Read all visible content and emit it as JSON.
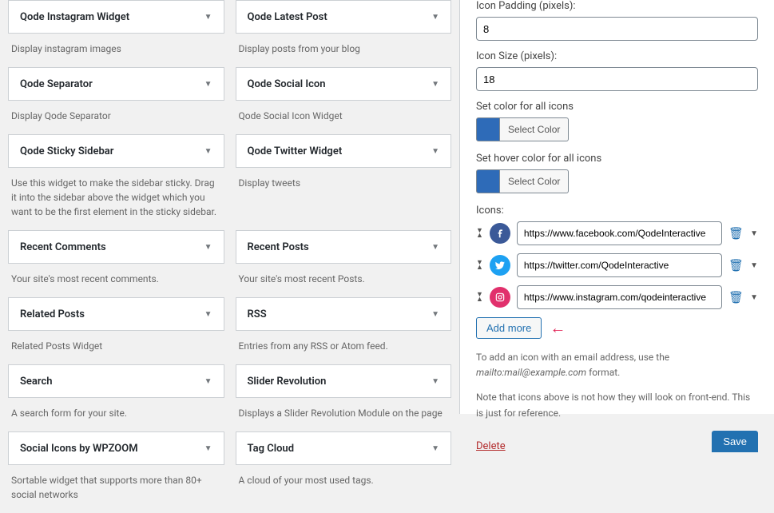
{
  "widgets_left": [
    {
      "title": "Qode Instagram Widget",
      "desc": "Display instagram images"
    },
    {
      "title": "Qode Separator",
      "desc": "Display Qode Separator"
    },
    {
      "title": "Qode Sticky Sidebar",
      "desc": "Use this widget to make the sidebar sticky. Drag it into the sidebar above the widget which you want to be the first element in the sticky sidebar."
    },
    {
      "title": "Recent Comments",
      "desc": "Your site's most recent comments."
    },
    {
      "title": "Related Posts",
      "desc": "Related Posts Widget"
    },
    {
      "title": "Search",
      "desc": "A search form for your site."
    },
    {
      "title": "Social Icons by WPZOOM",
      "desc": "Sortable widget that supports more than 80+ social networks"
    }
  ],
  "widgets_right": [
    {
      "title": "Qode Latest Post",
      "desc": "Display posts from your blog"
    },
    {
      "title": "Qode Social Icon",
      "desc": "Qode Social Icon Widget"
    },
    {
      "title": "Qode Twitter Widget",
      "desc": "Display tweets"
    },
    {
      "title": "Recent Posts",
      "desc": "Your site's most recent Posts."
    },
    {
      "title": "RSS",
      "desc": "Entries from any RSS or Atom feed."
    },
    {
      "title": "Slider Revolution",
      "desc": "Displays a Slider Revolution Module on the page"
    },
    {
      "title": "Tag Cloud",
      "desc": "A cloud of your most used tags."
    }
  ],
  "form": {
    "icon_padding_label": "Icon Padding (pixels):",
    "icon_padding_value": "8",
    "icon_size_label": "Icon Size (pixels):",
    "icon_size_value": "18",
    "color_label": "Set color for all icons",
    "hover_color_label": "Set hover color for all icons",
    "select_color_btn": "Select Color",
    "icons_label": "Icons:",
    "add_more_btn": "Add more",
    "help_text_1a": "To add an icon with an email address, use the ",
    "help_text_1b": "mailto:mail@example.com",
    "help_text_1c": " format.",
    "help_text_2": "Note that icons above is not how they will look on front-end. This is just for reference.",
    "delete_link": "Delete",
    "save_btn": "Save"
  },
  "icons": [
    {
      "url": "https://www.facebook.com/QodeInteractive",
      "type": "facebook"
    },
    {
      "url": "https://twitter.com/QodeInteractive",
      "type": "twitter"
    },
    {
      "url": "https://www.instagram.com/qodeinteractive",
      "type": "instagram"
    }
  ]
}
